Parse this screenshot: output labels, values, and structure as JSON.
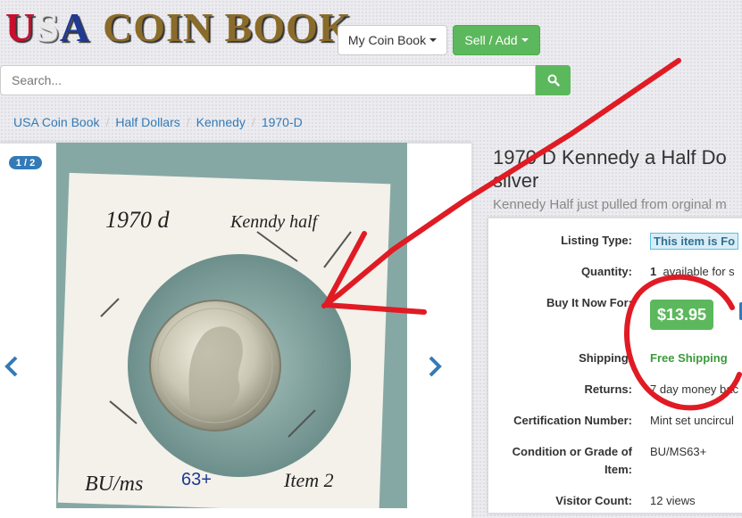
{
  "logo": {
    "u": "U",
    "s": "S",
    "a": "A",
    "rest": "COIN BOOK"
  },
  "header": {
    "my_coin_book": "My Coin Book",
    "sell_add": "Sell / Add"
  },
  "search": {
    "placeholder": "Search..."
  },
  "breadcrumbs": [
    "USA Coin Book",
    "Half Dollars",
    "Kennedy",
    "1970-D"
  ],
  "gallery": {
    "counter": "1 / 2"
  },
  "photo_text": {
    "top_left": "1970 d",
    "top_right": "Kenndy half",
    "bottom_left": "BU/ms",
    "bottom_mid": "63+",
    "bottom_right": "Item 2"
  },
  "listing": {
    "title": "1970 D Kennedy a Half Do silver",
    "subtitle": "Kennedy Half just pulled from orginal m",
    "labels": {
      "listing_type": "Listing Type:",
      "quantity": "Quantity:",
      "buy_it_now": "Buy It Now For:",
      "shipping": "Shipping:",
      "returns": "Returns:",
      "cert": "Certification Number:",
      "grade1": "Condition or Grade of",
      "grade2": "Item:",
      "visitor": "Visitor Count:"
    },
    "values": {
      "listing_type": "This item is Fo",
      "quantity_num": "1",
      "quantity_text": "available for s",
      "price": "$13.95",
      "shipping": "Free Shipping",
      "returns": "7 day money bac",
      "cert": "Mint set uncircul",
      "grade": "BU/MS63+",
      "visitor": "12 views"
    }
  },
  "annotation_color": "#e01b24"
}
